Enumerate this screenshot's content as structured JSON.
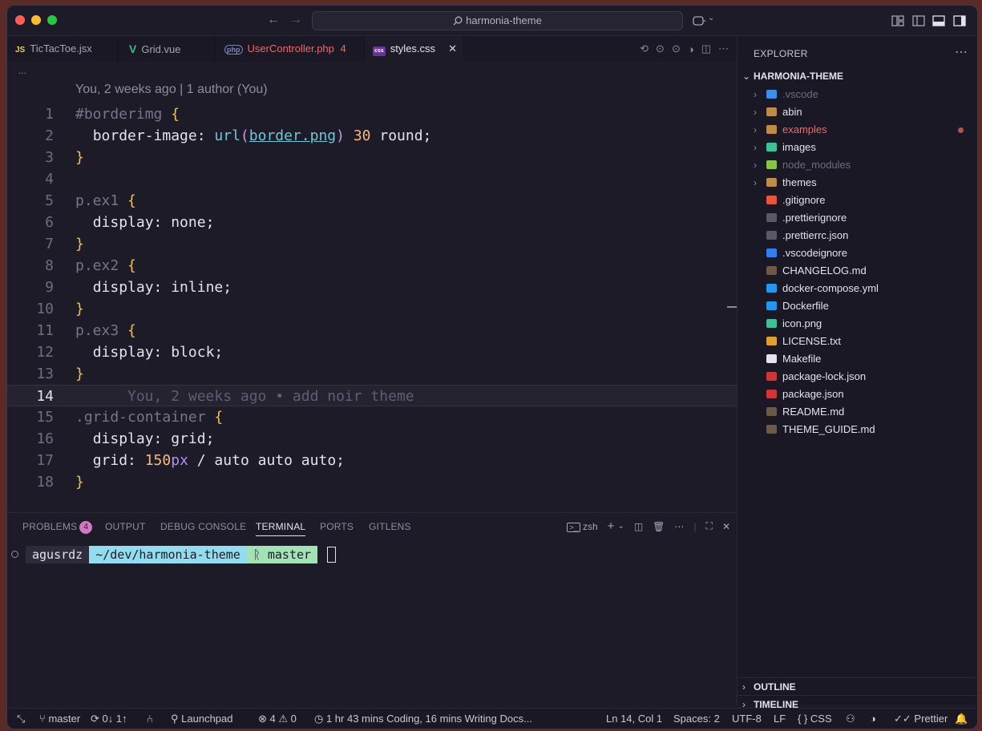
{
  "titlebar": {
    "search_text": "harmonia-theme",
    "back_icon": "arrow-left-icon",
    "forward_icon": "arrow-right-icon"
  },
  "tabs": [
    {
      "icon_text": "JS",
      "icon_color": "#e8d44d",
      "label": "TicTacToe.jsx",
      "active": false
    },
    {
      "icon_text": "V",
      "icon_color": "#42b883",
      "label": "Grid.vue",
      "active": false
    },
    {
      "icon_text": "php",
      "icon_color": "#7a86b8",
      "label": "UserController.php",
      "badge": "4",
      "label_color": "#e86a6a",
      "active": false
    },
    {
      "icon_text": "css",
      "icon_color": "#663399",
      "label": "styles.css",
      "active": true
    }
  ],
  "breadcrumb": "...",
  "editor": {
    "blame_header": "You, 2 weeks ago | 1 author (You)",
    "inline_blame": "You, 2 weeks ago • add noir theme",
    "line_numbers": [
      "1",
      "2",
      "3",
      "4",
      "5",
      "6",
      "7",
      "8",
      "9",
      "10",
      "11",
      "12",
      "13",
      "14",
      "15",
      "16",
      "17",
      "18"
    ],
    "current_line": 14
  },
  "code": {
    "l1_sel": "#borderimg",
    "l1_brace": "{",
    "l2_prop": "border-image: ",
    "l2_fn": "url",
    "l2_p1": "(",
    "l2_url": "border.png",
    "l2_p2": ")",
    "l2_num": "30",
    "l2_rest": " round;",
    "close_brace": "}",
    "l5_sel": "p.ex1",
    "l6": "display: none;",
    "l8_sel": "p.ex2",
    "l9": "display: inline;",
    "l11_sel": "p.ex3",
    "l12": "display: block;",
    "l15_sel": ".grid-container",
    "l16": "display: grid;",
    "l17_prop": "grid: ",
    "l17_num": "150",
    "l17_unit": "px",
    "l17_rest": " / auto auto auto;"
  },
  "panel": {
    "tabs": [
      "PROBLEMS",
      "OUTPUT",
      "DEBUG CONSOLE",
      "TERMINAL",
      "PORTS",
      "GITLENS"
    ],
    "problems_count": "4",
    "active_tab": "TERMINAL",
    "shell": "zsh"
  },
  "terminal": {
    "user": "agusrdz",
    "path": "~/dev/harmonia-theme",
    "branch": "ᚱ master"
  },
  "explorer": {
    "title": "EXPLORER",
    "root": "HARMONIA-THEME",
    "items": [
      {
        "name": ".vscode",
        "folder": true,
        "icon_color": "#3b8eea",
        "dim": true
      },
      {
        "name": "abin",
        "folder": true,
        "icon_color": "#c08a4a"
      },
      {
        "name": "examples",
        "folder": true,
        "icon_color": "#c08a4a",
        "modified": true
      },
      {
        "name": "images",
        "folder": true,
        "icon_color": "#3fbf9a"
      },
      {
        "name": "node_modules",
        "folder": true,
        "icon_color": "#8bc34a",
        "dim": true
      },
      {
        "name": "themes",
        "folder": true,
        "icon_color": "#c08a4a"
      },
      {
        "name": ".gitignore",
        "icon_color": "#e8553c"
      },
      {
        "name": ".prettierignore",
        "icon_color": "#5a5868"
      },
      {
        "name": ".prettierrc.json",
        "icon_color": "#5a5868"
      },
      {
        "name": ".vscodeignore",
        "icon_color": "#2f80ed"
      },
      {
        "name": "CHANGELOG.md",
        "icon_color": "#6b5a4a"
      },
      {
        "name": "docker-compose.yml",
        "icon_color": "#2496ed"
      },
      {
        "name": "Dockerfile",
        "icon_color": "#2496ed"
      },
      {
        "name": "icon.png",
        "icon_color": "#3fbf9a"
      },
      {
        "name": "LICENSE.txt",
        "icon_color": "#e0a030"
      },
      {
        "name": "Makefile",
        "icon_color": "#e4e2ef"
      },
      {
        "name": "package-lock.json",
        "icon_color": "#cb3837"
      },
      {
        "name": "package.json",
        "icon_color": "#cb3837"
      },
      {
        "name": "README.md",
        "icon_color": "#6b5a4a"
      },
      {
        "name": "THEME_GUIDE.md",
        "icon_color": "#6b5a4a"
      }
    ],
    "outline": "OUTLINE",
    "timeline": "TIMELINE"
  },
  "statusbar": {
    "branch": "master",
    "sync": "0↓ 1↑",
    "launchpad": "Launchpad",
    "errors": "4",
    "warnings": "0",
    "coding": "1 hr 43 mins Coding, 16 mins Writing Docs...",
    "position": "Ln 14, Col 1",
    "spaces": "Spaces: 2",
    "encoding": "UTF-8",
    "eol": "LF",
    "language": "CSS",
    "prettier": "Prettier"
  }
}
